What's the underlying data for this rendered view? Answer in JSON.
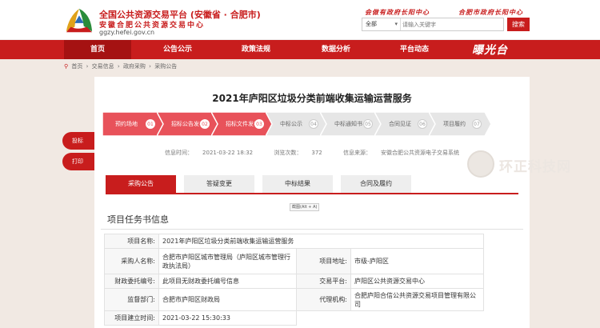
{
  "header": {
    "title": "全国公共资源交易平台 (安徽省 · 合肥市)",
    "subtitle": "安徽合肥公共资源交易中心",
    "domain": "ggzy.hefei.gov.cn",
    "slogan_left": "会做有政府长阳中心",
    "slogan_right": "合肥市政府长阳中心",
    "search": {
      "select_value": "全部",
      "placeholder": "请输入关键字",
      "button": "搜索"
    }
  },
  "nav": {
    "items": [
      "首页",
      "公告公示",
      "政策法规",
      "数据分析",
      "平台动态"
    ],
    "active": "首页",
    "logo_text": "曝光台"
  },
  "breadcrumb": [
    "首页",
    "交易信息",
    "政府采购",
    "采购公告"
  ],
  "page": {
    "title": "2021年庐阳区垃圾分类前端收集运输运营服务"
  },
  "steps": [
    {
      "label": "预约场地",
      "num": "01",
      "done": true
    },
    {
      "label": "招标公告发布",
      "num": "02",
      "done": true
    },
    {
      "label": "招标文件发布",
      "num": "03",
      "done": true
    },
    {
      "label": "中标公示",
      "num": "04",
      "done": false
    },
    {
      "label": "中标通知书",
      "num": "05",
      "done": false
    },
    {
      "label": "合同见证",
      "num": "06",
      "done": false
    },
    {
      "label": "项目履约",
      "num": "07",
      "done": false
    }
  ],
  "meta": {
    "time_label": "信息时间：",
    "time_value": "2021-03-22 18:32",
    "views_label": "浏览次数：",
    "views_value": "372",
    "source_label": "信息来源：",
    "source_value": "安徽合肥公共资源电子交易系统"
  },
  "side_actions": [
    "投标",
    "打印"
  ],
  "tabs": [
    "采购公告",
    "答疑变更",
    "中标结果",
    "合同及履约"
  ],
  "active_tab": "采购公告",
  "tooltip": "截图(Alt + A)",
  "section_title": "项目任务书信息",
  "info": {
    "project_name_label": "项目名称:",
    "project_name": "2021年庐阳区垃圾分类前端收集运输运营服务",
    "buyer_label": "采购人名称:",
    "buyer": "合肥市庐阳区城市管理局（庐阳区城市管理行政执法局）",
    "address_label": "项目地址:",
    "address": "市级-庐阳区",
    "finance_label": "财政委托编号:",
    "finance": "此项目无财政委托编号信息",
    "platform_label": "交易平台:",
    "platform": "庐阳区公共资源交易中心",
    "supervise_label": "监督部门:",
    "supervise": "合肥市庐阳区财政局",
    "agent_label": "代理机构:",
    "agent": "合肥庐阳合信公共资源交易项目管理有限公司",
    "created_label": "项目建立时间:",
    "created": "2021-03-22 15:30:33"
  },
  "watermark": "环正科技网",
  "colors": {
    "brand": "#c81d1d",
    "nav_active": "#a51212",
    "step_done": "#e8525a",
    "step_todo": "#e6e6e6"
  }
}
